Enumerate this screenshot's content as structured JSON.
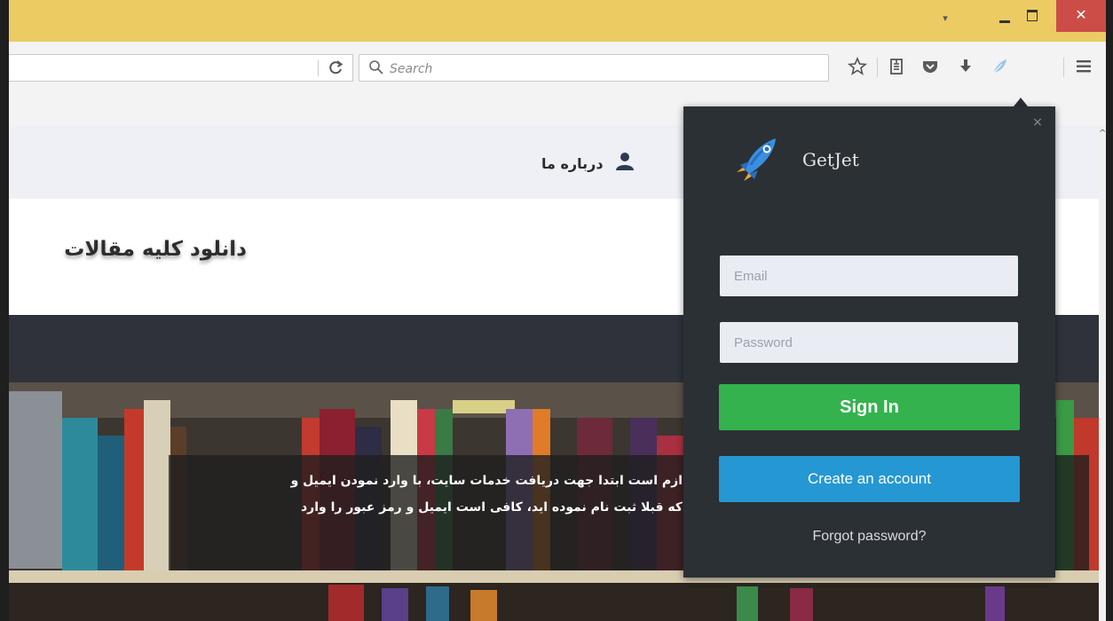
{
  "window": {
    "dropdown_glyph": "▾",
    "close_glyph": "✕",
    "titlebar_color": "#eccb62",
    "close_color": "#cc4d47"
  },
  "toolbar": {
    "reload_glyph": "C",
    "search_placeholder": "Search",
    "icons": [
      "star-icon",
      "reading-list-icon",
      "pocket-icon",
      "download-icon",
      "getjet-feather-icon",
      "hamburger-menu-icon"
    ]
  },
  "page": {
    "nav_about": "درباره ما",
    "site_title": "دانلود کلیه مقالات",
    "hero_line1": "ازم است ابتدا جهت دریافت خدمات سایت، با وارد نمودن ایمیل و",
    "hero_line2": "که قبلا ثبت نام نموده اید، کافی است ایمیل و رمز عبور را وارد"
  },
  "popup": {
    "brand": "GetJet",
    "close_glyph": "×",
    "email_placeholder": "Email",
    "password_placeholder": "Password",
    "signin_label": "Sign In",
    "create_label": "Create an account",
    "forgot_label": "Forgot password?",
    "signin_color": "#33b24e",
    "create_color": "#2597d3",
    "background": "#2b3035"
  }
}
